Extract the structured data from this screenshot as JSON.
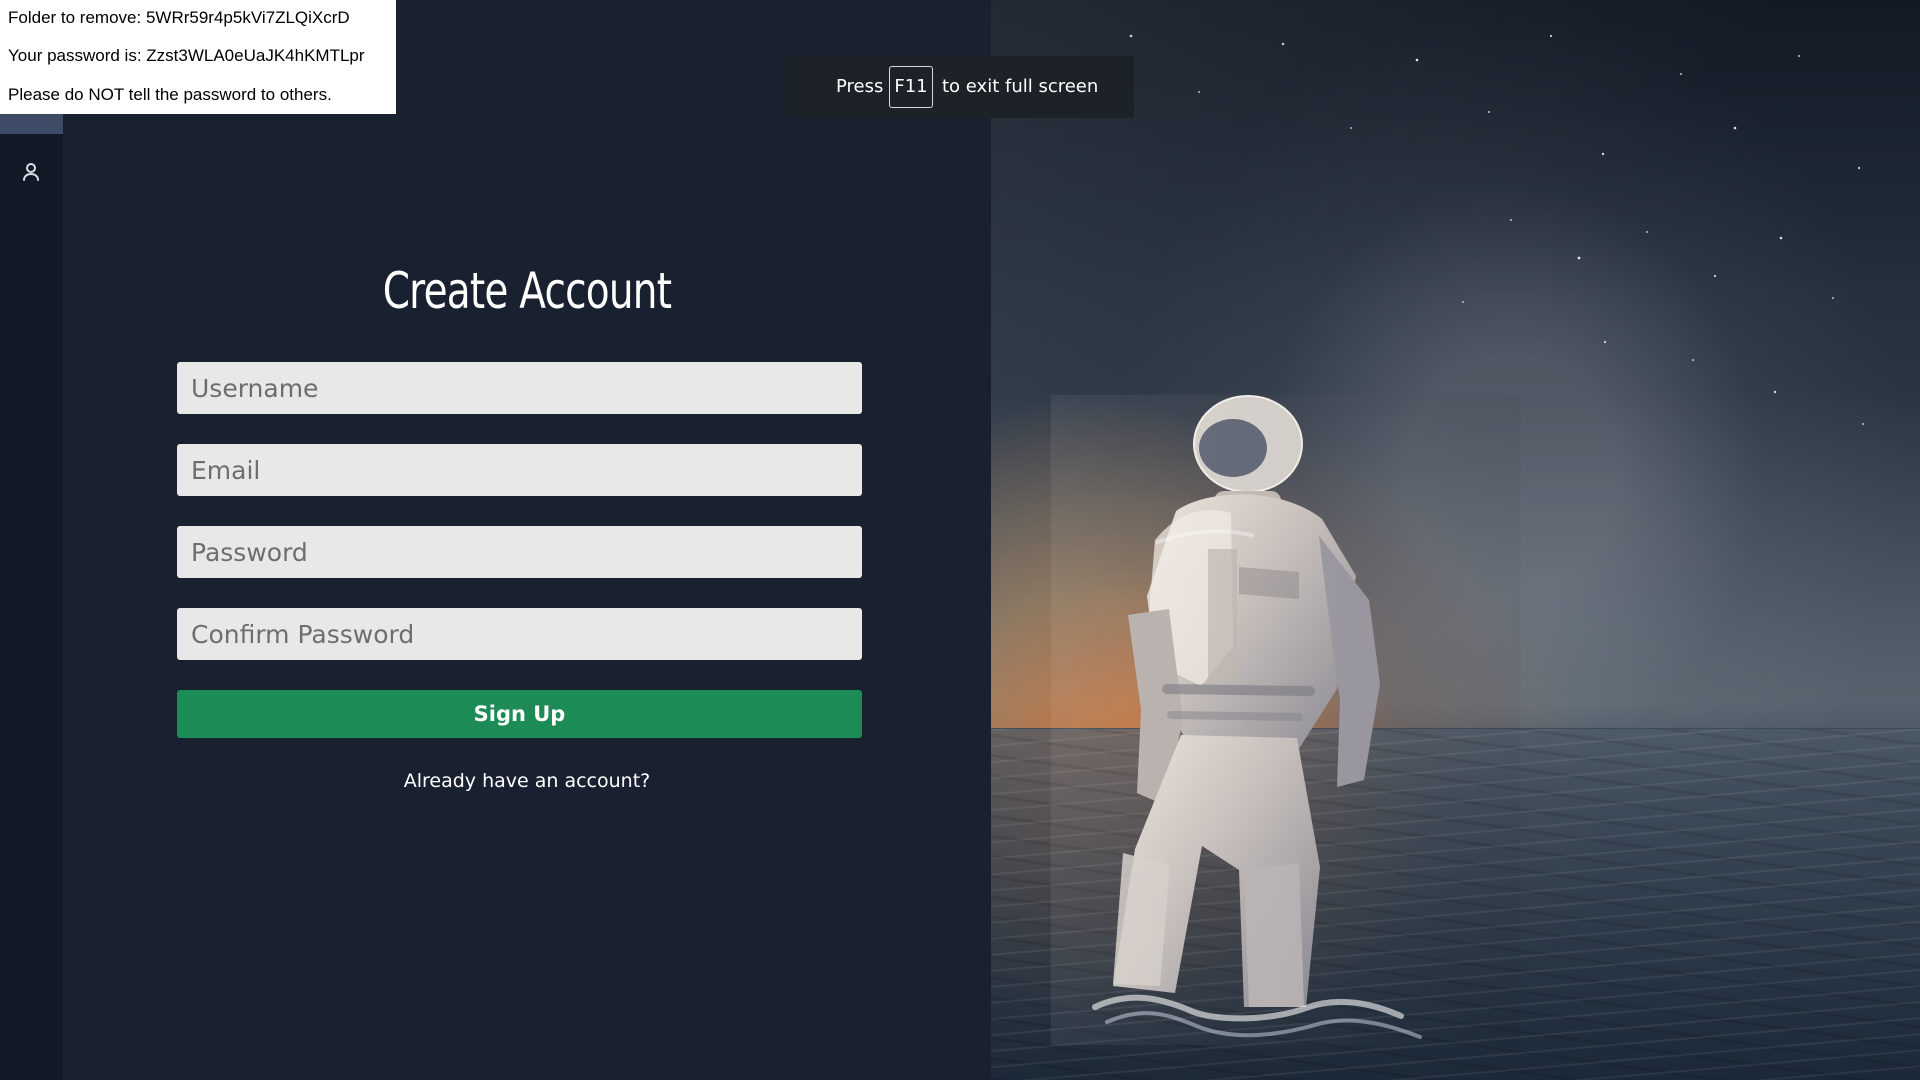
{
  "notice": {
    "folder_line": "Folder to remove: 5WRr59r4p5kVi7ZLQiXcrD",
    "password_line": "Your password is: Zzst3WLA0eUaJK4hKMTLpr",
    "warning_line": "Please do NOT tell the password to others."
  },
  "fullscreen_toast": {
    "press": "Press",
    "key": "F11",
    "rest": "to exit full screen"
  },
  "sidebar": {
    "icons": [
      "user-icon"
    ]
  },
  "form": {
    "title": "Create Account",
    "username_placeholder": "Username",
    "email_placeholder": "Email",
    "password_placeholder": "Password",
    "confirm_password_placeholder": "Confirm Password",
    "submit_label": "Sign Up",
    "login_link": "Already have an account?"
  },
  "colors": {
    "panel_bg": "#19202f",
    "rail_bg": "#121826",
    "input_bg": "#e8e8e8",
    "button_bg": "#1d8b55",
    "toast_bg": "#1d2229"
  }
}
